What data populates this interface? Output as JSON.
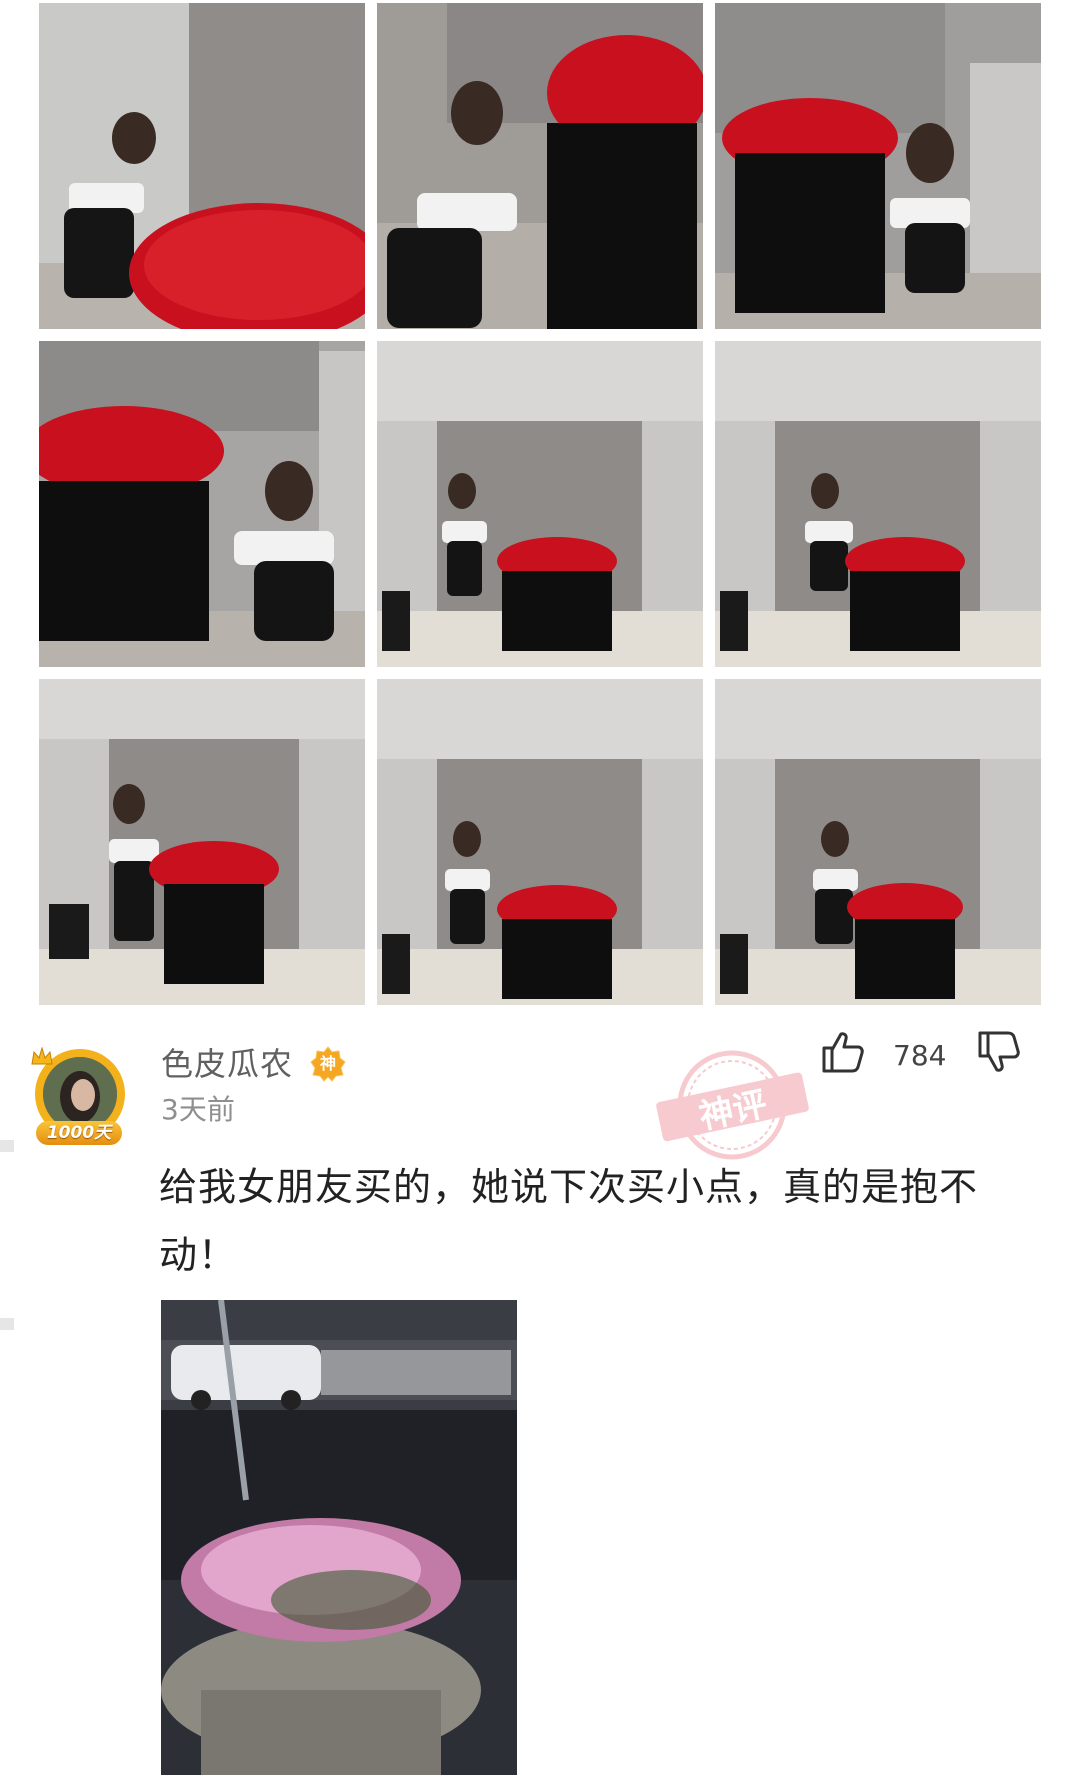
{
  "photos": [
    {
      "alt": "photo-1"
    },
    {
      "alt": "photo-2"
    },
    {
      "alt": "photo-3"
    },
    {
      "alt": "photo-4"
    },
    {
      "alt": "photo-5"
    },
    {
      "alt": "photo-6"
    },
    {
      "alt": "photo-7"
    },
    {
      "alt": "photo-8"
    },
    {
      "alt": "photo-9"
    }
  ],
  "comment": {
    "username": "色皮瓜农",
    "god_badge": "神",
    "avatar_badge": "1000天",
    "time": "3天前",
    "like_count": "784",
    "stamp_text": "神评",
    "text": "给我女朋友买的，她说下次买小点，真的是抱不动！"
  },
  "colors": {
    "rose_red": "#c8101e",
    "badge_orange": "#f5a623",
    "stamp_pink": "#f0a0a8"
  }
}
